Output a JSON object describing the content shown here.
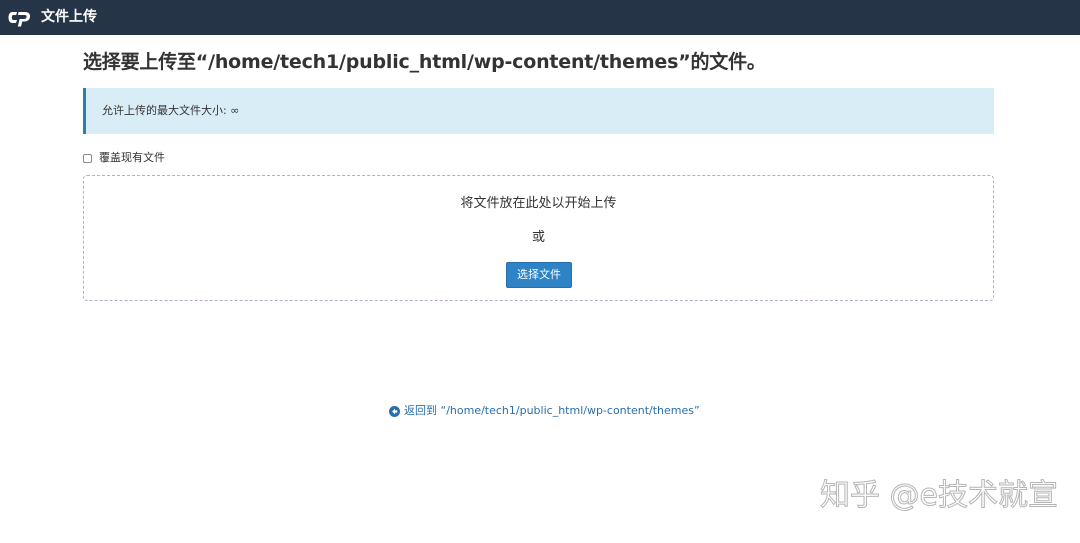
{
  "header": {
    "app_title": "文件上传",
    "logo": "cpanel-logo"
  },
  "main": {
    "page_title": "选择要上传至“/home/tech1/public_html/wp-content/themes”的文件。",
    "info_message": "允许上传的最大文件大小: ∞",
    "overwrite_label": "覆盖现有文件",
    "overwrite_checked": false,
    "dropzone_text": "将文件放在此处以开始上传",
    "or_text": "或",
    "select_button_label": "选择文件",
    "back_link_text": "返回到 “/home/tech1/public_html/wp-content/themes”",
    "back_icon": "arrow-circle-left-icon"
  },
  "watermark": {
    "text": "知乎 @e技术就宣"
  },
  "colors": {
    "header_bg": "#253547",
    "info_bg": "#d9edf7",
    "info_border": "#2a7fb0",
    "button_bg": "#2e83c7",
    "link": "#2a6fa8",
    "dropzone_border": "#b9a8cf"
  }
}
